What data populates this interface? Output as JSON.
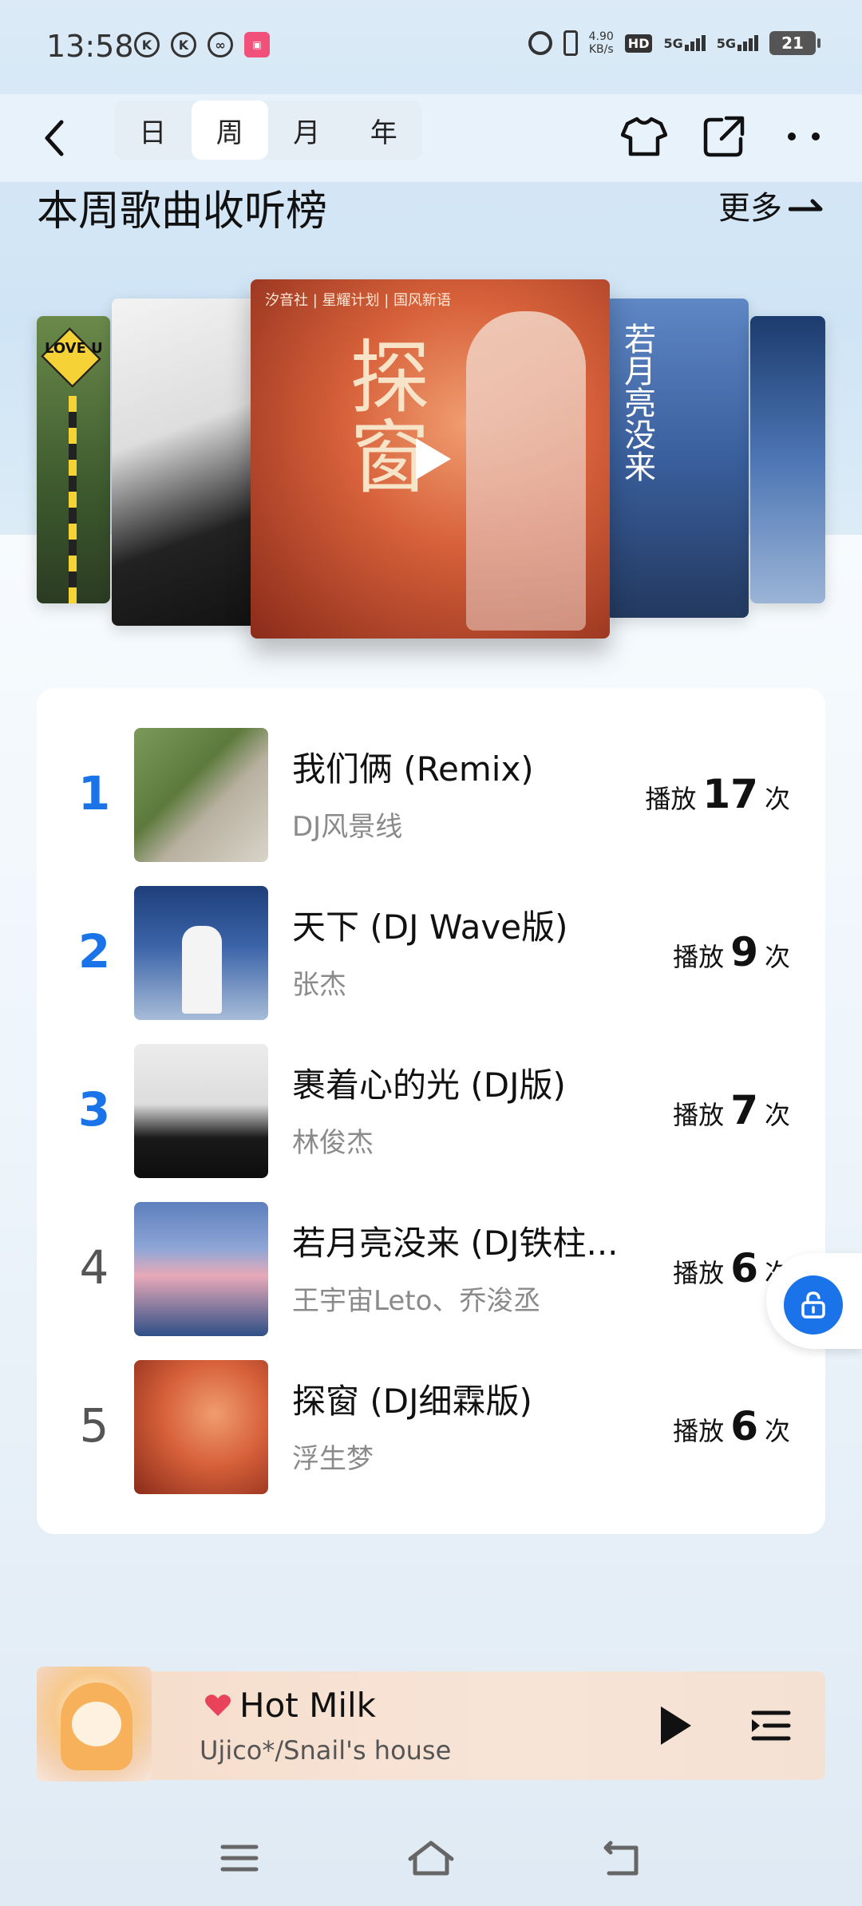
{
  "status_bar": {
    "time": "13:58",
    "net_speed_value": "4.90",
    "net_speed_unit": "KB/s",
    "hd_label": "HD",
    "signal_1": "5G",
    "signal_2": "5G",
    "battery": "21"
  },
  "header": {
    "tabs": [
      {
        "label": "日",
        "active": false
      },
      {
        "label": "周",
        "active": true
      },
      {
        "label": "月",
        "active": false
      },
      {
        "label": "年",
        "active": false
      }
    ],
    "icons": [
      "back-icon",
      "theme-shirt-icon",
      "share-icon",
      "more-icon"
    ]
  },
  "section": {
    "title": "本周歌曲收听榜",
    "more_label": "更多"
  },
  "carousel": {
    "center_cover": {
      "big_text": "探窗",
      "label_text": "汐音社 | 星耀计划 | 国风新语"
    },
    "side_texts": {
      "card_a": "LOVE U",
      "card_d": "若月亮没来"
    }
  },
  "ranking": [
    {
      "rank": "1",
      "title": "我们俩 (Remix)",
      "artist": "DJ风景线",
      "plays_prefix": "播放",
      "plays_count": "17",
      "plays_suffix": "次",
      "highlight": true
    },
    {
      "rank": "2",
      "title": "天下 (DJ Wave版)",
      "artist": "张杰",
      "plays_prefix": "播放",
      "plays_count": "9",
      "plays_suffix": "次",
      "highlight": true
    },
    {
      "rank": "3",
      "title": "裹着心的光 (DJ版)",
      "artist": "林俊杰",
      "plays_prefix": "播放",
      "plays_count": "7",
      "plays_suffix": "次",
      "highlight": true
    },
    {
      "rank": "4",
      "title": "若月亮没来 (DJ铁柱...",
      "artist": "王宇宙Leto、乔浚丞",
      "plays_prefix": "播放",
      "plays_count": "6",
      "plays_suffix": "次",
      "highlight": false
    },
    {
      "rank": "5",
      "title": "探窗 (DJ细霖版)",
      "artist": "浮生梦",
      "plays_prefix": "播放",
      "plays_count": "6",
      "plays_suffix": "次",
      "highlight": false
    }
  ],
  "player": {
    "title": "Hot Milk",
    "artist": "Ujico*/Snail's house"
  },
  "colors": {
    "accent": "#1a73e8",
    "heart": "#e8435a",
    "player_bg": "#f6dcc9"
  }
}
